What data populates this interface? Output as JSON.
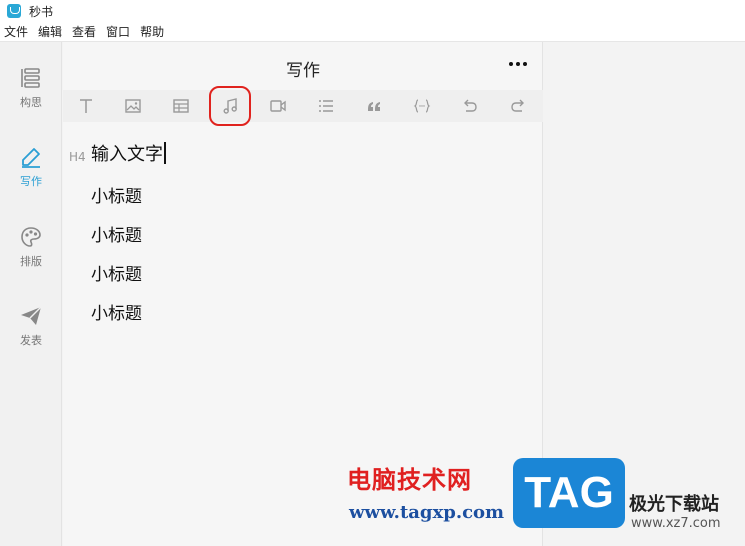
{
  "window": {
    "title": "秒书"
  },
  "menubar": {
    "items": [
      "文件",
      "编辑",
      "查看",
      "窗口",
      "帮助"
    ]
  },
  "sidebar": {
    "items": [
      {
        "label": "构思",
        "icon": "outline-icon"
      },
      {
        "label": "写作",
        "icon": "pen-icon",
        "active": true
      },
      {
        "label": "排版",
        "icon": "palette-icon"
      },
      {
        "label": "发表",
        "icon": "paper-plane-icon"
      }
    ]
  },
  "editor": {
    "title": "写作",
    "toolbar": [
      "text-icon",
      "image-icon",
      "table-icon",
      "music-icon",
      "video-icon",
      "list-icon",
      "quote-icon",
      "code-icon",
      "undo-icon",
      "redo-icon"
    ],
    "highlighted_tool": "music-icon",
    "heading_marker": "H4",
    "lines": [
      "输入文字",
      "小标题",
      "小标题",
      "小标题",
      "小标题"
    ]
  },
  "watermark": {
    "cn_text": "电脑技术网",
    "url": "www.tagxp.com",
    "badge": "TAG",
    "site_name": "极光下载站",
    "site_url": "www.xz7.com"
  },
  "colors": {
    "accent": "#2b9fd4",
    "highlight": "#e0231e"
  }
}
